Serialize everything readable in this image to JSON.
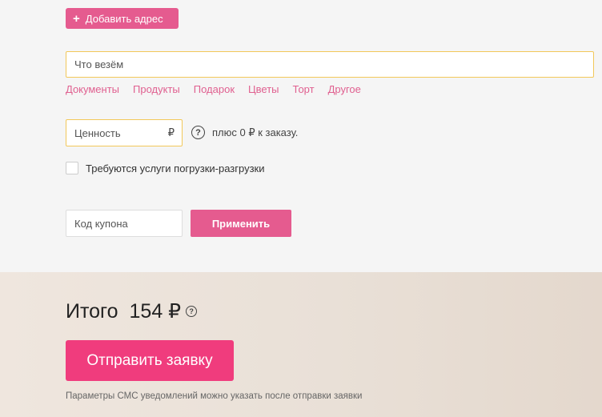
{
  "address": {
    "add_label": "Добавить адрес",
    "plus_icon": "+"
  },
  "cargo": {
    "placeholder": "Что везём",
    "chips": [
      "Документы",
      "Продукты",
      "Подарок",
      "Цветы",
      "Торт",
      "Другое"
    ]
  },
  "value": {
    "placeholder": "Ценность",
    "currency": "₽",
    "help_icon": "?",
    "plus_text": "плюс 0 ₽ к заказу."
  },
  "loading": {
    "label": "Требуются услуги погрузки-разгрузки",
    "checked": false
  },
  "coupon": {
    "placeholder": "Код купона",
    "apply_label": "Применить"
  },
  "total": {
    "label": "Итого",
    "amount": "154 ₽",
    "help_icon": "?"
  },
  "submit": {
    "label": "Отправить заявку"
  },
  "note": "Параметры СМС уведомлений можно указать после отправки заявки",
  "colors": {
    "accent": "#e55b8f",
    "submit": "#f03c7d",
    "focus_border": "#f2c85a"
  }
}
